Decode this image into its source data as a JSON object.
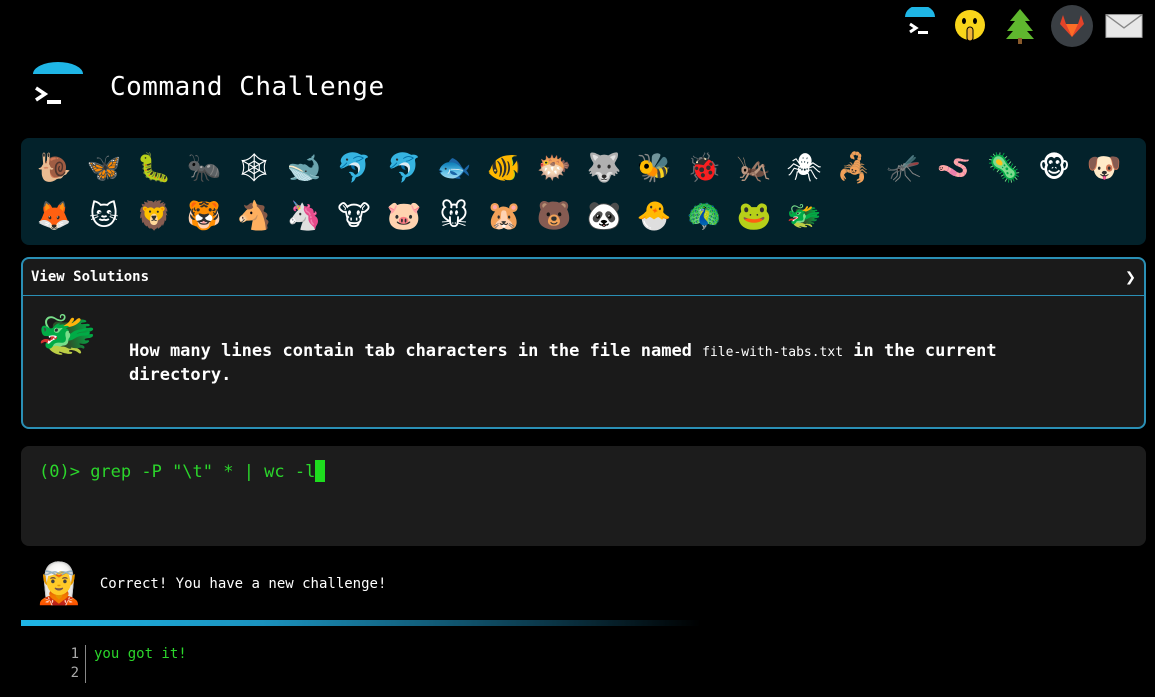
{
  "nav": {
    "icons": [
      "terminal-icon",
      "shushing-face-icon",
      "tree-icon",
      "gitlab-icon",
      "envelope-icon"
    ]
  },
  "header": {
    "title": "Command Challenge"
  },
  "challenges": {
    "row1": [
      "🐌",
      "🦋",
      "🐛",
      "🐜",
      "🕸",
      "🐋",
      "🐬",
      "🐬",
      "🐟",
      "🐠",
      "🐡",
      "🐺",
      "🐝",
      "🐞",
      "🦗",
      "🕷",
      "🦂",
      "🦟",
      "🪱",
      "🦠",
      "🐵",
      "🐶"
    ],
    "row2": [
      "🦊",
      "🐱",
      "🦁",
      "🐯",
      "🐴",
      "🦄",
      "🐮",
      "🐷",
      "🐭",
      "🐹",
      "🐻",
      "🐼",
      "🐣",
      "🦚",
      "🐸",
      "🐲"
    ]
  },
  "panel": {
    "header_label": "View Solutions",
    "current_icon": "🐲",
    "question_before": "How many lines contain tab characters in the file named ",
    "question_file": "file-with-tabs.txt",
    "question_after": " in the current directory."
  },
  "terminal": {
    "prompt": "(0)> ",
    "command": "grep -P \"\\t\" * | wc -l"
  },
  "feedback": {
    "icon": "🧝",
    "text": "Correct! You have a new challenge!"
  },
  "output": {
    "line_numbers": [
      "1",
      "2"
    ],
    "lines": [
      "you got it!",
      ""
    ]
  },
  "colors": {
    "accent": "#1fb6e6",
    "terminal_green": "#2bd52b",
    "panel_border": "#2a8fb5",
    "icon_bar_bg": "#03222b"
  }
}
